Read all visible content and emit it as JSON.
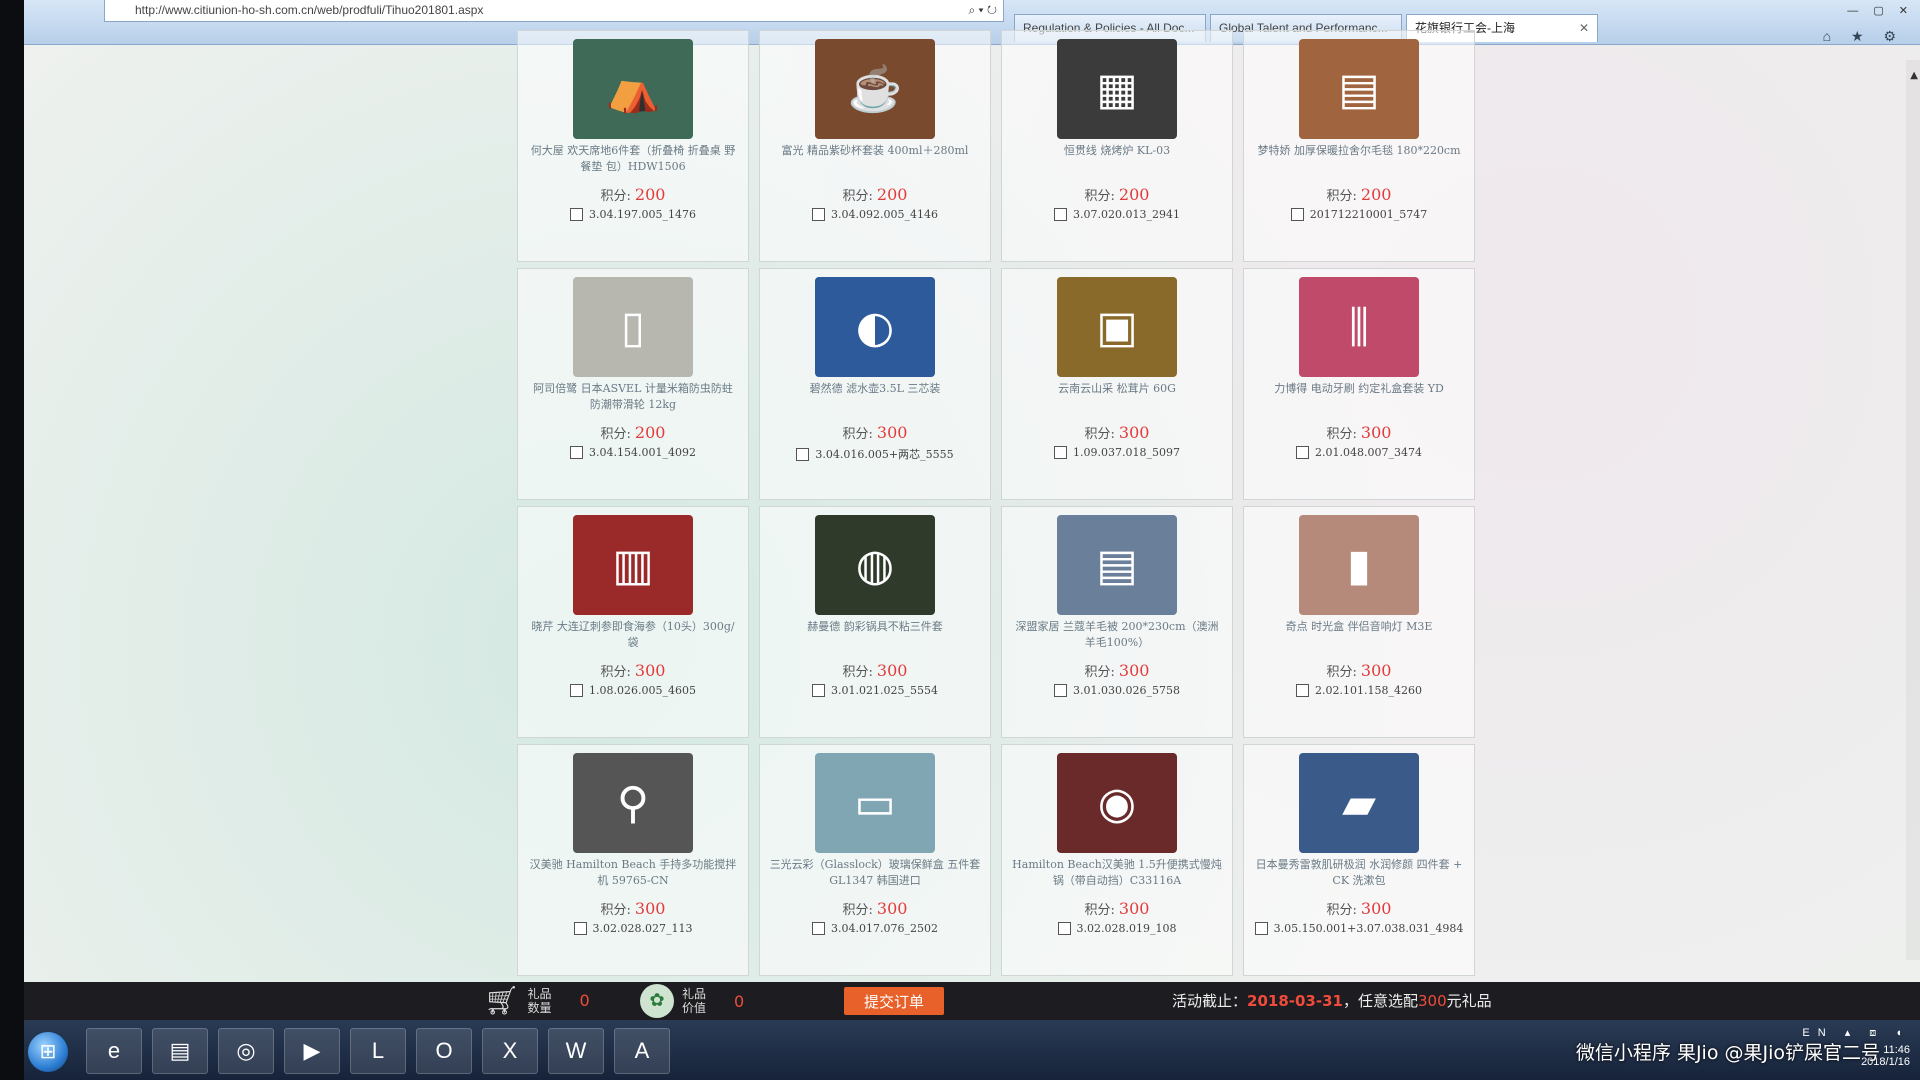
{
  "browser": {
    "url": "http://www.citiunion-ho-sh.com.cn/web/prodfuli/Tihuo201801.aspx",
    "tabs": [
      {
        "label": "Regulation & Policies - All Doc...",
        "active": false
      },
      {
        "label": "Global Talent and Performanc...",
        "active": false
      },
      {
        "label": "花旗银行工会-上海",
        "active": true
      }
    ]
  },
  "products": [
    {
      "name": "何大屋 欢天席地6件套（折叠椅 折叠桌 野餐垫 包）HDW1506",
      "points_label": "积分:",
      "points": "200",
      "code": "3.04.197.005_1476",
      "icon": "⛺",
      "color": "#3f6a58"
    },
    {
      "name": "富光 精品紫砂杯套装 400ml＋280ml",
      "points_label": "积分:",
      "points": "200",
      "code": "3.04.092.005_4146",
      "icon": "☕",
      "color": "#7a4a2e"
    },
    {
      "name": "恒贯线 烧烤炉 KL-03",
      "points_label": "积分:",
      "points": "200",
      "code": "3.07.020.013_2941",
      "icon": "▦",
      "color": "#3b3b3b"
    },
    {
      "name": "梦特娇 加厚保暖拉舍尔毛毯 180*220cm",
      "points_label": "积分:",
      "points": "200",
      "code": "201712210001_5747",
      "icon": "▤",
      "color": "#a0643e"
    },
    {
      "name": "阿司倍鹭 日本ASVEL 计量米箱防虫防蛀 防潮带滑轮 12kg",
      "points_label": "积分:",
      "points": "200",
      "code": "3.04.154.001_4092",
      "icon": "▯",
      "color": "#b7b7b0"
    },
    {
      "name": "碧然德 滤水壶3.5L 三芯装",
      "points_label": "积分:",
      "points": "300",
      "code": "3.04.016.005+两芯_5555",
      "icon": "◐",
      "color": "#2d5a9a"
    },
    {
      "name": "云南云山采 松茸片 60G",
      "points_label": "积分:",
      "points": "300",
      "code": "1.09.037.018_5097",
      "icon": "▣",
      "color": "#8a6a2a"
    },
    {
      "name": "力博得 电动牙刷 约定礼盒套装 YD",
      "points_label": "积分:",
      "points": "300",
      "code": "2.01.048.007_3474",
      "icon": "⫼",
      "color": "#c04a6a"
    },
    {
      "name": "晓芹 大连辽刺参即食海参（10头）300g/袋",
      "points_label": "积分:",
      "points": "300",
      "code": "1.08.026.005_4605",
      "icon": "▥",
      "color": "#9a2a2a"
    },
    {
      "name": "赫曼德 韵彩锅具不粘三件套",
      "points_label": "积分:",
      "points": "300",
      "code": "3.01.021.025_5554",
      "icon": "◍",
      "color": "#2f3a2a"
    },
    {
      "name": "深盟家居 兰蔻羊毛被 200*230cm（澳洲羊毛100%）",
      "points_label": "积分:",
      "points": "300",
      "code": "3.01.030.026_5758",
      "icon": "▤",
      "color": "#6a7f9a"
    },
    {
      "name": "奇点 时光盒 伴侣音响灯 M3E",
      "points_label": "积分:",
      "points": "300",
      "code": "2.02.101.158_4260",
      "icon": "▮",
      "color": "#b58a7a"
    },
    {
      "name": "汉美驰 Hamilton Beach 手持多功能搅拌机 59765-CN",
      "points_label": "积分:",
      "points": "300",
      "code": "3.02.028.027_113",
      "icon": "⚲",
      "color": "#555555"
    },
    {
      "name": "三光云彩（Glasslock）玻璃保鲜盒 五件套 GL1347 韩国进口",
      "points_label": "积分:",
      "points": "300",
      "code": "3.04.017.076_2502",
      "icon": "▭",
      "color": "#7fa6b2"
    },
    {
      "name": "Hamilton Beach汉美驰 1.5升便携式慢炖锅（带自动挡）C33116A",
      "points_label": "积分:",
      "points": "300",
      "code": "3.02.028.019_108",
      "icon": "◉",
      "color": "#6a2a2a"
    },
    {
      "name": "日本曼秀雷敦肌研极润 水润修颜 四件套 + CK 洗漱包",
      "points_label": "积分:",
      "points": "300",
      "code": "3.05.150.001+3.07.038.031_4984",
      "icon": "▰",
      "color": "#3a5a8a"
    }
  ],
  "summary": {
    "gift_count_label": "礼品\n数量",
    "gift_count": "0",
    "gift_value_label": "礼品\n价值",
    "gift_value": "0",
    "submit_label": "提交订单",
    "deadline_prefix": "活动截止：",
    "deadline_date": "2018-03-31",
    "deadline_mid": "，任意选配",
    "deadline_amount": "300",
    "deadline_suffix": "元礼品"
  },
  "taskbar": {
    "apps": [
      {
        "name": "ie-icon",
        "glyph": "e"
      },
      {
        "name": "explorer-icon",
        "glyph": "▤"
      },
      {
        "name": "chrome-icon",
        "glyph": "◎"
      },
      {
        "name": "media-player-icon",
        "glyph": "▶"
      },
      {
        "name": "lync-icon",
        "glyph": "L"
      },
      {
        "name": "outlook-icon",
        "glyph": "O"
      },
      {
        "name": "excel-icon",
        "glyph": "X"
      },
      {
        "name": "word-icon",
        "glyph": "W"
      },
      {
        "name": "acrobat-icon",
        "glyph": "A"
      }
    ],
    "lang": "EN",
    "time": "11:46",
    "date": "2018/1/16"
  },
  "watermark": "微信小程序 果Jio @果Jio铲屎官二号"
}
